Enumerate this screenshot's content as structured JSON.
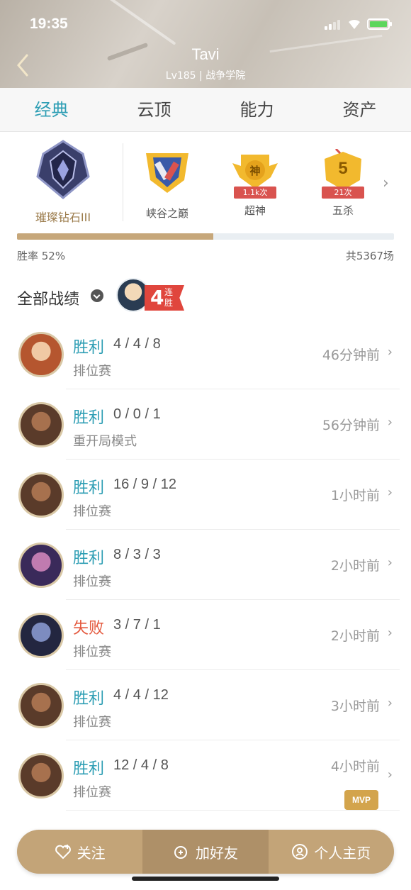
{
  "status": {
    "time": "19:35"
  },
  "header": {
    "name": "Tavi",
    "subtitle": "Lv185 | 战争学院",
    "back_icon": "chevron-left-icon"
  },
  "tabs": [
    {
      "label": "经典",
      "active": true
    },
    {
      "label": "云顶",
      "active": false
    },
    {
      "label": "能力",
      "active": false
    },
    {
      "label": "资产",
      "active": false
    }
  ],
  "rank": {
    "label": "璀璨钻石III"
  },
  "badges": [
    {
      "label": "峡谷之巅",
      "count": ""
    },
    {
      "label": "超神",
      "count": "1.1k次",
      "glyph": "神"
    },
    {
      "label": "五杀",
      "count": "21次",
      "glyph": "5"
    }
  ],
  "stats": {
    "winrate": "胜率 52%",
    "winrate_value": 0.52,
    "total": "共5367场"
  },
  "records": {
    "title": "全部战绩",
    "streak_num": "4",
    "streak_text": "连胜"
  },
  "matches": [
    {
      "result": "胜利",
      "outcome": "win",
      "kda": "4 / 4 / 8",
      "mode": "排位赛",
      "time": "46分钟前",
      "mvp": false
    },
    {
      "result": "胜利",
      "outcome": "win",
      "kda": "0 / 0 / 1",
      "mode": "重开局模式",
      "time": "56分钟前",
      "mvp": false
    },
    {
      "result": "胜利",
      "outcome": "win",
      "kda": "16 / 9 / 12",
      "mode": "排位赛",
      "time": "1小时前",
      "mvp": false
    },
    {
      "result": "胜利",
      "outcome": "win",
      "kda": "8 / 3 / 3",
      "mode": "排位赛",
      "time": "2小时前",
      "mvp": false
    },
    {
      "result": "失败",
      "outcome": "loss",
      "kda": "3 / 7 / 1",
      "mode": "排位赛",
      "time": "2小时前",
      "mvp": false
    },
    {
      "result": "胜利",
      "outcome": "win",
      "kda": "4 / 4 / 12",
      "mode": "排位赛",
      "time": "3小时前",
      "mvp": false
    },
    {
      "result": "胜利",
      "outcome": "win",
      "kda": "12 / 4 / 8",
      "mode": "排位赛",
      "time": "4小时前",
      "mvp": true,
      "mvp_label": "MVP"
    }
  ],
  "bottom_bar": {
    "follow": "关注",
    "add_friend": "加好友",
    "profile": "个人主页"
  },
  "colors": {
    "win": "#2e9eb4",
    "loss": "#e45a3f",
    "gold": "#c3a478"
  }
}
